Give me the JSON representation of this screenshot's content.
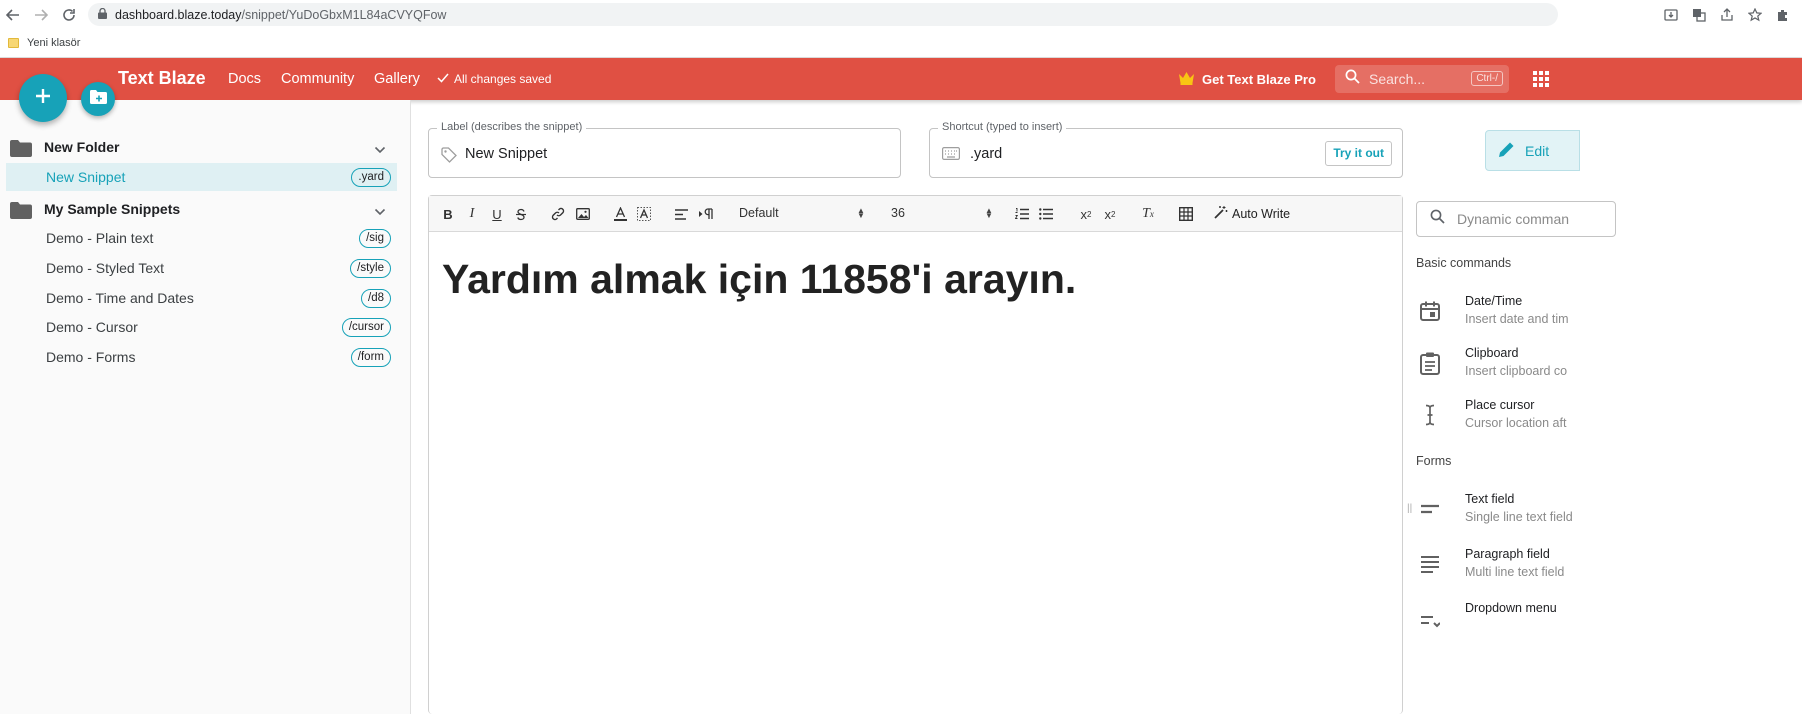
{
  "browser": {
    "url_host": "dashboard.blaze.today",
    "url_path": "/snippet/YuDoGbxM1L84aCVYQFow",
    "bookmark": "Yeni klasör"
  },
  "header": {
    "brand": "Text Blaze",
    "nav": [
      "Docs",
      "Community",
      "Gallery"
    ],
    "saved_status": "All changes saved",
    "pro_label": "Get Text Blaze Pro",
    "search_placeholder": "Search...",
    "search_shortcut": "Ctrl-/"
  },
  "sidebar": {
    "folders": [
      {
        "name": "New Folder",
        "snippets": [
          {
            "name": "New Snippet",
            "shortcut": ".yard",
            "active": true
          }
        ]
      },
      {
        "name": "My Sample Snippets",
        "snippets": [
          {
            "name": "Demo - Plain text",
            "shortcut": "/sig"
          },
          {
            "name": "Demo - Styled Text",
            "shortcut": "/style"
          },
          {
            "name": "Demo - Time and Dates",
            "shortcut": "/d8"
          },
          {
            "name": "Demo - Cursor",
            "shortcut": "/cursor"
          },
          {
            "name": "Demo - Forms",
            "shortcut": "/form"
          }
        ]
      }
    ]
  },
  "fields": {
    "label_legend": "Label (describes the snippet)",
    "label_value": "New Snippet",
    "shortcut_legend": "Shortcut (typed to insert)",
    "shortcut_value": ".yard",
    "try_button": "Try it out"
  },
  "toolbar": {
    "font_select": "Default",
    "size_select": "36",
    "auto_write": "Auto Write",
    "sub_label": "x",
    "sub_mark": "2",
    "sup_label": "x",
    "sup_mark": "2",
    "clear_label": "T",
    "clear_mark": "x"
  },
  "editor": {
    "content": "Yardım almak için 11858'i arayın."
  },
  "right_panel": {
    "edit_tab": "Edit",
    "search_placeholder": "Dynamic comman",
    "sections": [
      {
        "title": "Basic commands",
        "items": [
          {
            "title": "Date/Time",
            "desc": "Insert date and tim",
            "icon": "calendar-icon"
          },
          {
            "title": "Clipboard",
            "desc": "Insert clipboard co",
            "icon": "clipboard-icon"
          },
          {
            "title": "Place cursor",
            "desc": "Cursor location aft",
            "icon": "text-cursor-icon"
          }
        ]
      },
      {
        "title": "Forms",
        "items": [
          {
            "title": "Text field",
            "desc": "Single line text field",
            "icon": "short-text-icon"
          },
          {
            "title": "Paragraph field",
            "desc": "Multi line text field",
            "icon": "paragraph-icon"
          },
          {
            "title": "Dropdown menu",
            "desc": "",
            "icon": "dropdown-icon"
          }
        ]
      }
    ]
  },
  "colors": {
    "header": "#e05043",
    "accent": "#17a2b8"
  }
}
